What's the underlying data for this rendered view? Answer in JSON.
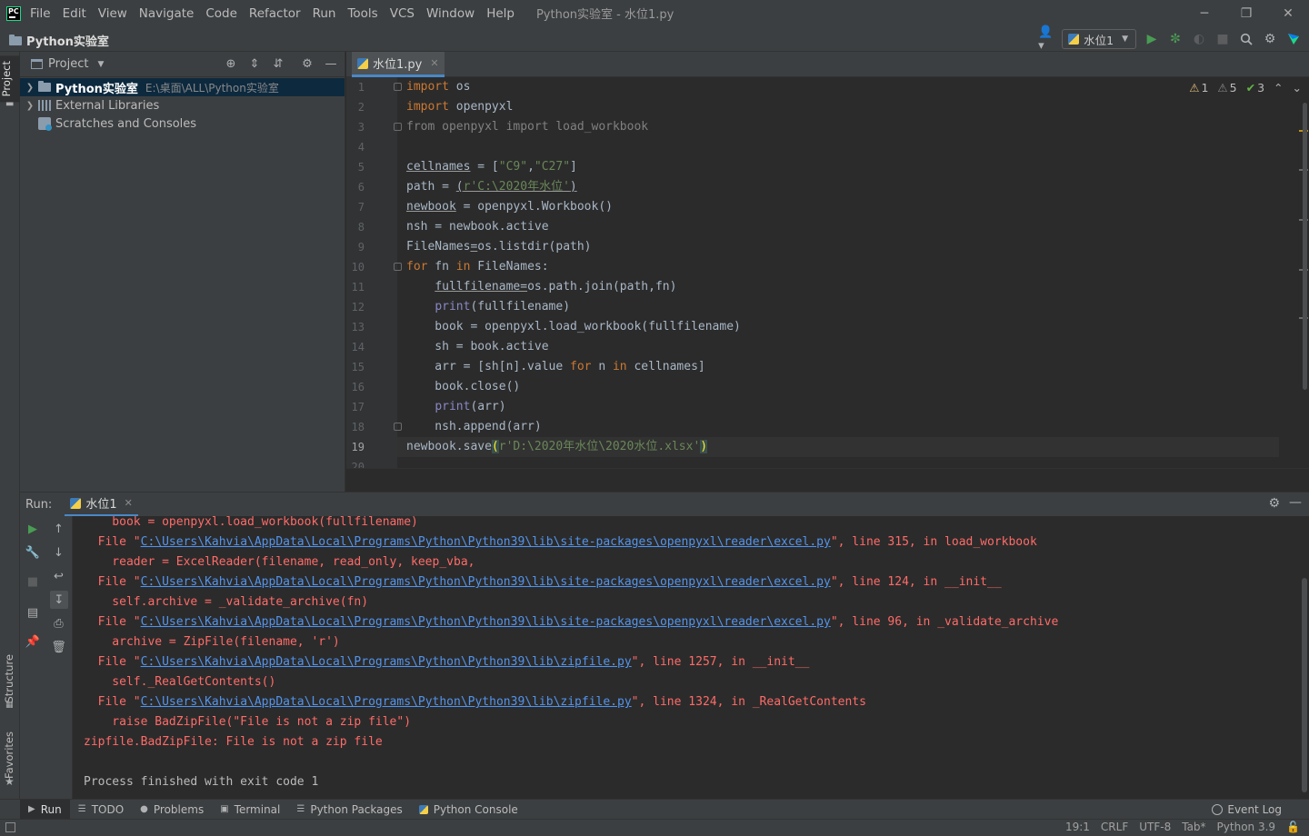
{
  "window": {
    "menu": [
      "File",
      "Edit",
      "View",
      "Navigate",
      "Code",
      "Refactor",
      "Run",
      "Tools",
      "VCS",
      "Window",
      "Help"
    ],
    "title": "Python实验室 - 水位1.py",
    "controls": {
      "minimize": "─",
      "restore": "❐",
      "close": "✕"
    }
  },
  "navbar": {
    "breadcrumb": "Python实验室",
    "run_config": "水位1"
  },
  "sidebar": {
    "project_tab": "Project",
    "structure_tab": "Structure",
    "favorites_tab": "Favorites"
  },
  "project": {
    "title": "Project",
    "tree": [
      {
        "name": "Python实验室",
        "path": "E:\\桌面\\ALL\\Python实验室"
      },
      {
        "name": "External Libraries"
      },
      {
        "name": "Scratches and Consoles"
      }
    ]
  },
  "editor": {
    "tab": "水位1.py",
    "inspections": {
      "warn_a": "1",
      "warn_b": "5",
      "ok": "3"
    },
    "current_line": 19,
    "line_numbers": [
      "1",
      "2",
      "3",
      "4",
      "5",
      "6",
      "7",
      "8",
      "9",
      "10",
      "11",
      "12",
      "13",
      "14",
      "15",
      "16",
      "17",
      "18",
      "19",
      "20"
    ]
  },
  "run": {
    "label": "Run:",
    "tab": "水位1",
    "console_lines": [
      "    book = openpyxl.load_workbook(fullfilename)",
      "  File \"C:\\Users\\Kahvia\\AppData\\Local\\Programs\\Python\\Python39\\lib\\site-packages\\openpyxl\\reader\\excel.py\", line 315, in load_workbook",
      "    reader = ExcelReader(filename, read_only, keep_vba,",
      "  File \"C:\\Users\\Kahvia\\AppData\\Local\\Programs\\Python\\Python39\\lib\\site-packages\\openpyxl\\reader\\excel.py\", line 124, in __init__",
      "    self.archive = _validate_archive(fn)",
      "  File \"C:\\Users\\Kahvia\\AppData\\Local\\Programs\\Python\\Python39\\lib\\site-packages\\openpyxl\\reader\\excel.py\", line 96, in _validate_archive",
      "    archive = ZipFile(filename, 'r')",
      "  File \"C:\\Users\\Kahvia\\AppData\\Local\\Programs\\Python\\Python39\\lib\\zipfile.py\", line 1257, in __init__",
      "    self._RealGetContents()",
      "  File \"C:\\Users\\Kahvia\\AppData\\Local\\Programs\\Python\\Python39\\lib\\zipfile.py\", line 1324, in _RealGetContents",
      "    raise BadZipFile(\"File is not a zip file\")",
      "zipfile.BadZipFile: File is not a zip file",
      "",
      "Process finished with exit code 1"
    ]
  },
  "bottom_tools": [
    "Run",
    "TODO",
    "Problems",
    "Terminal",
    "Python Packages",
    "Python Console"
  ],
  "event_log": "Event Log",
  "status": {
    "position": "19:1",
    "line_sep": "CRLF",
    "encoding": "UTF-8",
    "indent": "Tab*",
    "interpreter": "Python 3.9"
  },
  "colors": {
    "keyword": "#cc7832",
    "string": "#6a8759",
    "error": "#ff6b68",
    "link": "#5394ec",
    "accent": "#4a88c7"
  }
}
